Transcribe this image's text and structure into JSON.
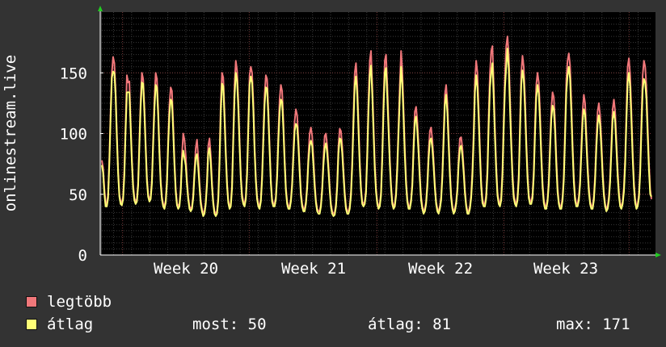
{
  "chart_data": {
    "type": "line",
    "ylabel": "onlinestream.live",
    "ylim": [
      0,
      200
    ],
    "yticks": [
      0,
      50,
      100,
      150
    ],
    "x_labels": [
      "Week 20",
      "Week 21",
      "Week 22",
      "Week 23"
    ],
    "grid": true,
    "legend_placement": "bottom-left",
    "series": [
      {
        "name": "legtöbb",
        "color": "#f0777a",
        "values": [
          78,
          72,
          55,
          43,
          42,
          50,
          80,
          118,
          150,
          163,
          158,
          135,
          100,
          70,
          50,
          44,
          43,
          48,
          70,
          108,
          148,
          142,
          143,
          110,
          80,
          58,
          47,
          44,
          46,
          60,
          95,
          128,
          150,
          145,
          122,
          92,
          64,
          50,
          46,
          48,
          62,
          96,
          128,
          150,
          145,
          120,
          88,
          62,
          48,
          42,
          40,
          45,
          62,
          96,
          124,
          138,
          135,
          108,
          78,
          55,
          43,
          40,
          42,
          55,
          82,
          100,
          95,
          82,
          62,
          48,
          40,
          38,
          40,
          50,
          70,
          88,
          95,
          80,
          60,
          45,
          38,
          34,
          36,
          44,
          62,
          90,
          96,
          82,
          60,
          44,
          36,
          34,
          36,
          48,
          80,
          126,
          150,
          146,
          118,
          86,
          60,
          45,
          40,
          42,
          58,
          100,
          140,
          160,
          152,
          128,
          95,
          66,
          50,
          44,
          42,
          48,
          70,
          110,
          148,
          155,
          150,
          126,
          90,
          64,
          48,
          42,
          40,
          46,
          66,
          100,
          132,
          148,
          145,
          120,
          90,
          62,
          46,
          42,
          42,
          48,
          68,
          100,
          128,
          140,
          135,
          110,
          80,
          56,
          44,
          40,
          40,
          46,
          60,
          86,
          110,
          120,
          115,
          96,
          72,
          52,
          42,
          38,
          38,
          44,
          58,
          82,
          100,
          105,
          98,
          80,
          60,
          45,
          38,
          36,
          36,
          42,
          56,
          80,
          98,
          100,
          90,
          74,
          56,
          42,
          36,
          34,
          35,
          42,
          60,
          90,
          104,
          102,
          90,
          70,
          52,
          40,
          36,
          36,
          40,
          52,
          78,
          115,
          150,
          158,
          140,
          110,
          78,
          56,
          44,
          42,
          44,
          54,
          86,
          128,
          160,
          168,
          140,
          108,
          76,
          55,
          44,
          40,
          42,
          52,
          84,
          128,
          160,
          165,
          140,
          110,
          80,
          58,
          44,
          40,
          42,
          52,
          76,
          108,
          140,
          168,
          152,
          120,
          88,
          62,
          46,
          40,
          40,
          46,
          60,
          92,
          118,
          122,
          110,
          90,
          66,
          48,
          40,
          36,
          38,
          44,
          60,
          85,
          102,
          105,
          95,
          78,
          58,
          44,
          38,
          36,
          40,
          48,
          68,
          100,
          132,
          140,
          125,
          98,
          70,
          50,
          40,
          36,
          38,
          44,
          56,
          80,
          96,
          97,
          88,
          72,
          54,
          42,
          36,
          36,
          40,
          50,
          70,
          102,
          144,
          160,
          150,
          120,
          88,
          60,
          46,
          42,
          42,
          50,
          72,
          115,
          150,
          168,
          172,
          140,
          104,
          74,
          52,
          44,
          42,
          48,
          70,
          112,
          148,
          172,
          180,
          165,
          130,
          96,
          68,
          50,
          44,
          42,
          48,
          66,
          108,
          150,
          164,
          155,
          130,
          96,
          68,
          50,
          44,
          44,
          50,
          70,
          108,
          140,
          150,
          142,
          118,
          86,
          60,
          46,
          40,
          40,
          46,
          62,
          92,
          120,
          134,
          130,
          110,
          80,
          56,
          44,
          40,
          40,
          48,
          66,
          104,
          144,
          160,
          166,
          156,
          126,
          92,
          64,
          48,
          42,
          42,
          48,
          62,
          90,
          118,
          132,
          125,
          100,
          75,
          56,
          44,
          40,
          40,
          48,
          66,
          95,
          118,
          125,
          115,
          95,
          70,
          52,
          42,
          38,
          40,
          48,
          64,
          92,
          120,
          128,
          118,
          95,
          70,
          52,
          42,
          40,
          44,
          56,
          80,
          118,
          155,
          162,
          148,
          118,
          86,
          60,
          46,
          40,
          42,
          50,
          72,
          112,
          148,
          160,
          155,
          138,
          106,
          76,
          54,
          46
        ],
        "current": 50,
        "average": 81,
        "max": 171
      },
      {
        "name": "átlag",
        "color": "#ffff77",
        "values": [
          74,
          68,
          51,
          40,
          40,
          47,
          76,
          113,
          146,
          151,
          150,
          131,
          96,
          67,
          48,
          42,
          41,
          46,
          66,
          103,
          134,
          134,
          134,
          105,
          76,
          55,
          45,
          42,
          44,
          57,
          90,
          122,
          142,
          141,
          117,
          88,
          61,
          48,
          44,
          46,
          59,
          91,
          120,
          140,
          138,
          115,
          84,
          59,
          46,
          40,
          38,
          43,
          59,
          91,
          116,
          128,
          126,
          102,
          74,
          52,
          41,
          38,
          40,
          52,
          77,
          86,
          80,
          74,
          58,
          46,
          38,
          36,
          38,
          47,
          66,
          80,
          83,
          72,
          56,
          42,
          36,
          32,
          34,
          42,
          58,
          84,
          88,
          76,
          56,
          42,
          34,
          32,
          34,
          45,
          75,
          117,
          141,
          139,
          112,
          82,
          57,
          43,
          38,
          40,
          55,
          94,
          130,
          150,
          144,
          121,
          90,
          63,
          47,
          42,
          40,
          46,
          66,
          104,
          140,
          147,
          142,
          120,
          86,
          61,
          46,
          40,
          38,
          44,
          62,
          94,
          124,
          138,
          137,
          114,
          86,
          59,
          44,
          40,
          40,
          46,
          64,
          94,
          118,
          128,
          126,
          104,
          76,
          53,
          42,
          38,
          38,
          44,
          57,
          81,
          102,
          108,
          106,
          90,
          68,
          49,
          40,
          36,
          36,
          42,
          55,
          77,
          90,
          94,
          90,
          74,
          56,
          43,
          36,
          34,
          34,
          40,
          53,
          74,
          88,
          92,
          84,
          70,
          53,
          40,
          34,
          32,
          33,
          40,
          56,
          84,
          96,
          95,
          84,
          66,
          49,
          38,
          34,
          34,
          38,
          49,
          73,
          108,
          140,
          147,
          132,
          103,
          73,
          53,
          42,
          40,
          42,
          51,
          81,
          119,
          148,
          156,
          132,
          101,
          71,
          52,
          42,
          38,
          40,
          49,
          79,
          119,
          150,
          154,
          130,
          103,
          75,
          55,
          42,
          38,
          40,
          49,
          71,
          101,
          130,
          155,
          141,
          113,
          82,
          58,
          44,
          38,
          38,
          44,
          57,
          86,
          110,
          114,
          102,
          84,
          62,
          45,
          38,
          34,
          36,
          42,
          56,
          79,
          94,
          96,
          88,
          73,
          55,
          42,
          36,
          34,
          38,
          45,
          64,
          94,
          124,
          132,
          117,
          91,
          65,
          47,
          38,
          34,
          36,
          42,
          53,
          75,
          88,
          90,
          82,
          68,
          51,
          40,
          34,
          34,
          38,
          47,
          65,
          95,
          134,
          148,
          138,
          112,
          82,
          56,
          43,
          40,
          40,
          47,
          67,
          107,
          138,
          150,
          158,
          130,
          97,
          69,
          49,
          42,
          40,
          45,
          65,
          104,
          138,
          155,
          170,
          154,
          121,
          90,
          63,
          47,
          42,
          40,
          45,
          62,
          101,
          140,
          152,
          145,
          121,
          90,
          63,
          47,
          42,
          42,
          47,
          65,
          100,
          130,
          140,
          133,
          110,
          80,
          56,
          43,
          38,
          38,
          44,
          58,
          86,
          112,
          123,
          120,
          102,
          74,
          52,
          42,
          38,
          38,
          45,
          62,
          97,
          134,
          148,
          155,
          145,
          117,
          86,
          60,
          45,
          40,
          40,
          45,
          58,
          84,
          110,
          120,
          116,
          93,
          70,
          52,
          42,
          38,
          38,
          45,
          62,
          88,
          108,
          115,
          107,
          88,
          65,
          49,
          40,
          36,
          38,
          45,
          60,
          86,
          112,
          118,
          110,
          88,
          65,
          49,
          40,
          38,
          42,
          52,
          74,
          110,
          142,
          150,
          138,
          110,
          80,
          56,
          43,
          38,
          40,
          47,
          67,
          104,
          136,
          145,
          142,
          128,
          98,
          70,
          50,
          48
        ],
        "current": 50,
        "average": 81,
        "max": 171
      }
    ],
    "stats_labels": {
      "current": "most:",
      "average": "átlag:",
      "max": "max:"
    }
  }
}
